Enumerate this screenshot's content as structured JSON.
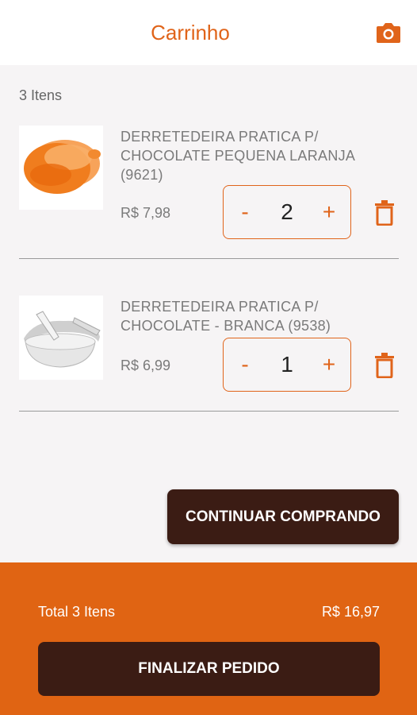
{
  "header": {
    "title": "Carrinho",
    "camera_icon": "camera-icon",
    "accent": "#e0641a"
  },
  "cart": {
    "count_label": "3 Itens",
    "items": [
      {
        "name": "DERRETEDEIRA PRATICA P/ CHOCOLATE PEQUENA LARANJA (9621)",
        "price": "R$ 7,98",
        "qty": "2",
        "minus": "-",
        "plus": "+",
        "image": "orange-bowl-image"
      },
      {
        "name": "DERRETEDEIRA PRATICA P/ CHOCOLATE - BRANCA (9538)",
        "price": "R$ 6,99",
        "qty": "1",
        "minus": "-",
        "plus": "+",
        "image": "white-bowl-image"
      }
    ]
  },
  "actions": {
    "continue_label": "CONTINUAR COMPRANDO"
  },
  "footer": {
    "total_label": "Total 3 Itens",
    "total_value": "R$ 16,97",
    "finish_label": "FINALIZAR PEDIDO",
    "bg": "#e06413",
    "button_bg": "#3b1c14"
  }
}
